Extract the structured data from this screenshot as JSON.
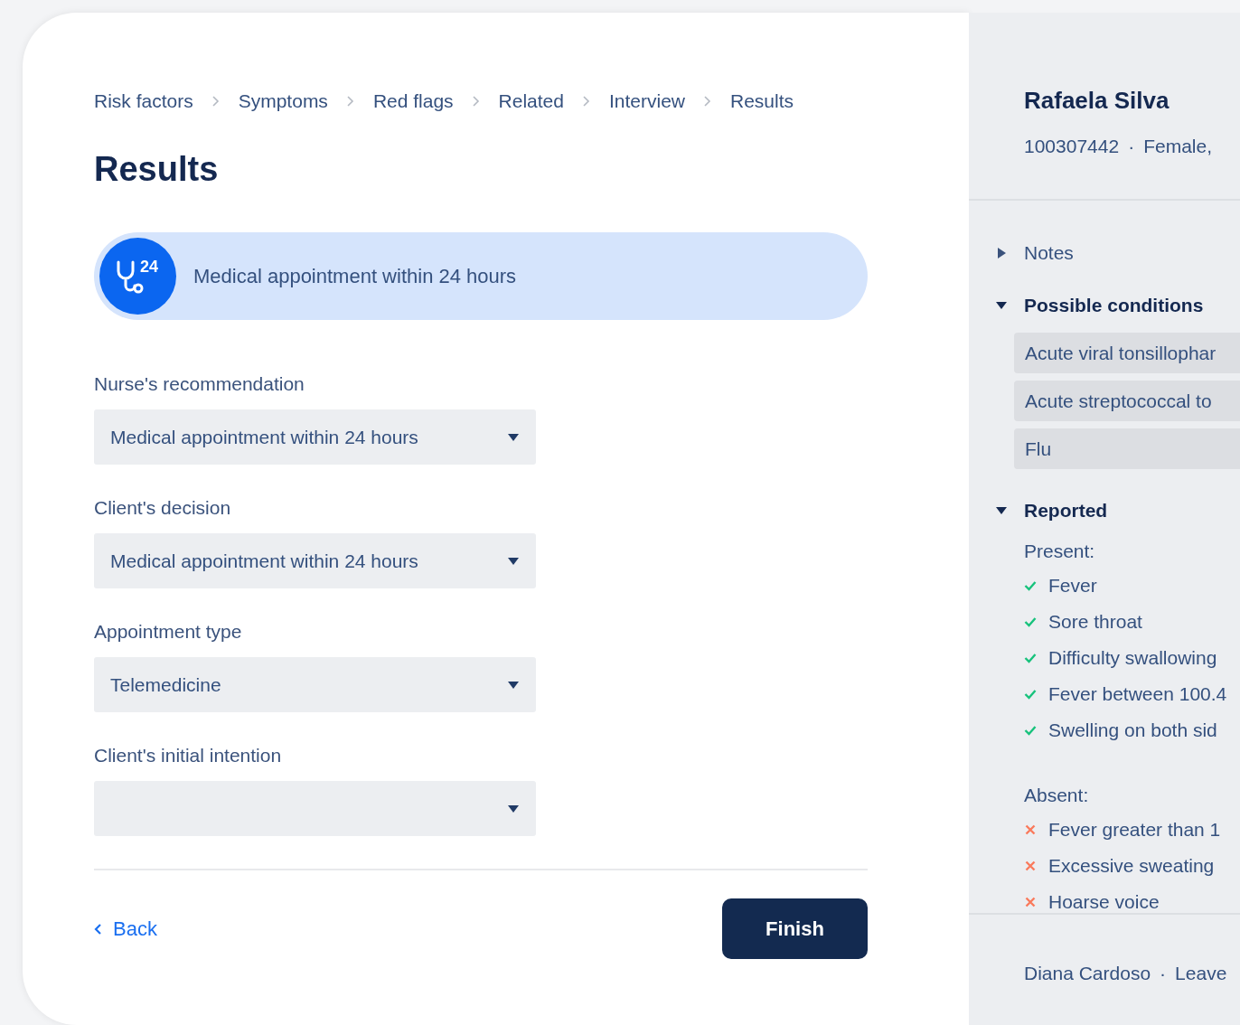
{
  "breadcrumbs": [
    "Risk factors",
    "Symptoms",
    "Red flags",
    "Related",
    "Interview",
    "Results"
  ],
  "title": "Results",
  "recommendation_banner": {
    "badge": "24",
    "text": "Medical appointment within 24 hours"
  },
  "form_fields": [
    {
      "label": "Nurse's recommendation",
      "value": "Medical appointment within 24 hours"
    },
    {
      "label": "Client's decision",
      "value": "Medical appointment within 24 hours"
    },
    {
      "label": "Appointment type",
      "value": "Telemedicine"
    },
    {
      "label": "Client's initial intention"
    }
  ],
  "back_link": "Back",
  "finish_button": "Finish",
  "patient": {
    "name": "Rafaela Silva",
    "id": "100307442",
    "separator": "·",
    "details": "Female,"
  },
  "sections": [
    {
      "kind": "notes",
      "title": "Notes",
      "expanded": false
    },
    {
      "kind": "conditions",
      "title": "Possible conditions",
      "expanded": true,
      "items": [
        "Acute viral tonsillophar",
        "Acute streptococcal to",
        "Flu"
      ]
    },
    {
      "kind": "reported",
      "title": "Reported",
      "expanded": true,
      "groups": [
        {
          "title": "Present:",
          "symptoms": [
            {
              "name": "Fever",
              "present": true
            },
            {
              "name": "Sore throat",
              "present": true
            },
            {
              "name": "Difficulty swallowing",
              "present": true
            },
            {
              "name": "Fever between 100.4",
              "present": true
            },
            {
              "name": "Swelling on both sid",
              "present": true
            }
          ]
        },
        {
          "title": "Absent:",
          "symptoms": [
            {
              "name": "Fever greater than 1",
              "present": false
            },
            {
              "name": "Excessive sweating",
              "present": false
            },
            {
              "name": "Hoarse voice",
              "present": false
            }
          ]
        }
      ]
    }
  ],
  "footer": {
    "user": "Diana Cardoso",
    "separator": "·",
    "action": "Leave"
  }
}
